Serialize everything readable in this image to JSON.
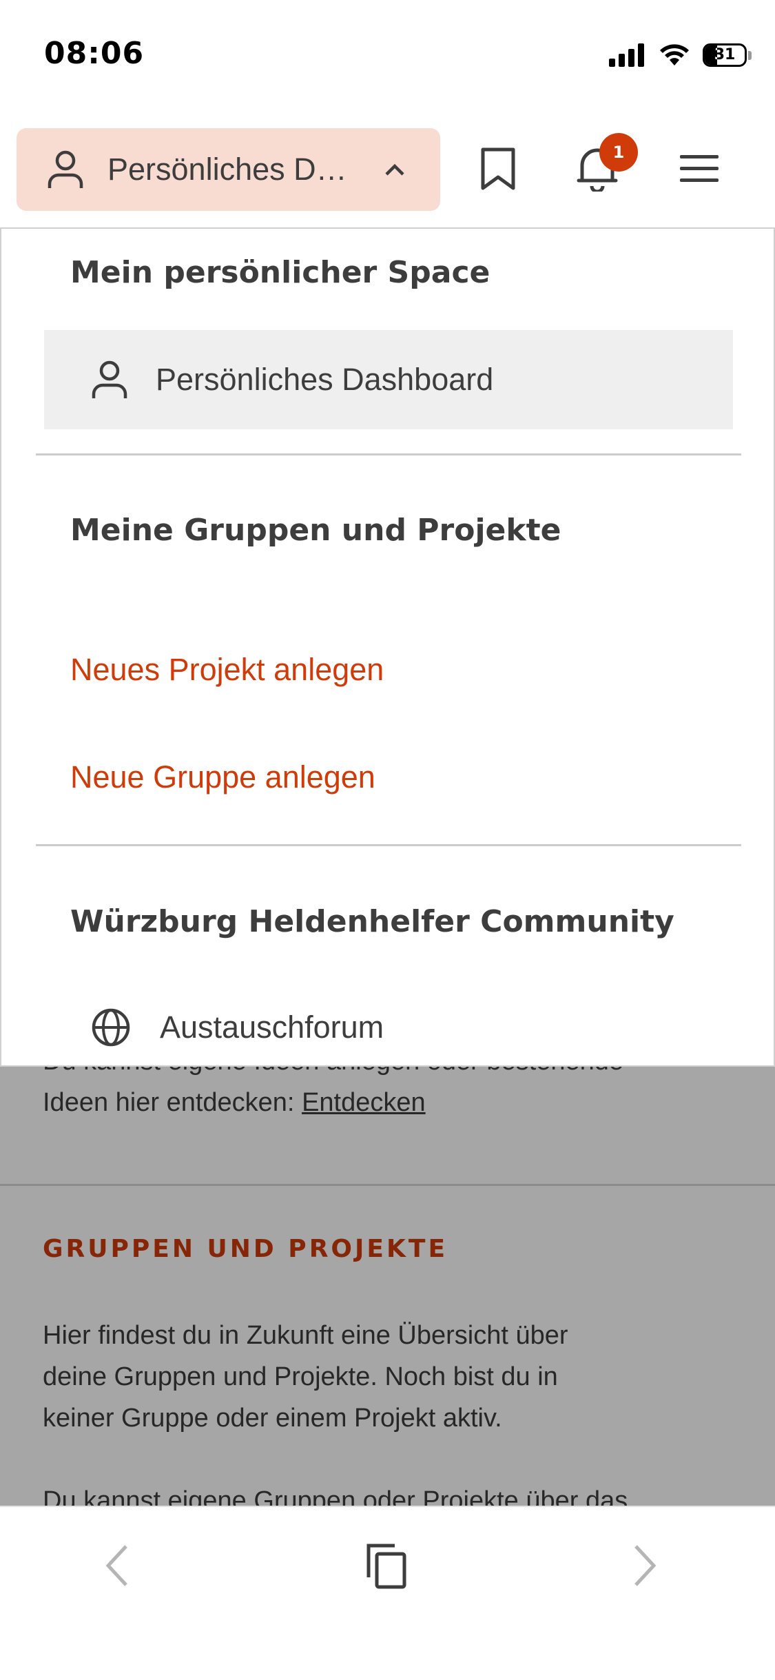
{
  "status_bar": {
    "time": "08:06",
    "battery": "31",
    "battery_level_percent": 31,
    "icons": [
      "signal-icon",
      "wifi-icon",
      "battery-icon"
    ]
  },
  "header": {
    "space_switcher_label": "Persönliches Dashboard",
    "icons": [
      "person-icon",
      "chevron-up-icon",
      "bookmark-icon",
      "bell-icon",
      "hamburger-menu-icon"
    ],
    "notification_count": "1"
  },
  "dropdown": {
    "section_personal_title": "Mein persönlicher Space",
    "personal_dashboard_label": "Persönliches Dashboard",
    "section_groups_title": "Meine Gruppen und Projekte",
    "new_project_label": "Neues Projekt anlegen",
    "new_group_label": "Neue Gruppe anlegen",
    "section_community_title": "Würzburg Heldenhelfer Community",
    "forum_label": "Austauschforum"
  },
  "page": {
    "ideas_partial_line": "Du kannst eigene Ideen anlegen oder bestehende",
    "ideas_text": "Ideen hier entdecken: ",
    "ideas_link": "Entdecken",
    "groups_heading": "GRUPPEN UND PROJEKTE",
    "groups_text_line1": "Hier findest du in Zukunft eine Übersicht über",
    "groups_text_line2": "deine Gruppen und Projekte. Noch bist du in",
    "groups_text_line3": "keiner Gruppe oder einem Projekt aktiv.",
    "groups_text_cut": "Du kannst eigene Gruppen oder Projekte über das"
  },
  "colors": {
    "accent": "#d03b0a",
    "switcher_bg": "#f8dbd1",
    "active_item_bg": "#efefef"
  }
}
